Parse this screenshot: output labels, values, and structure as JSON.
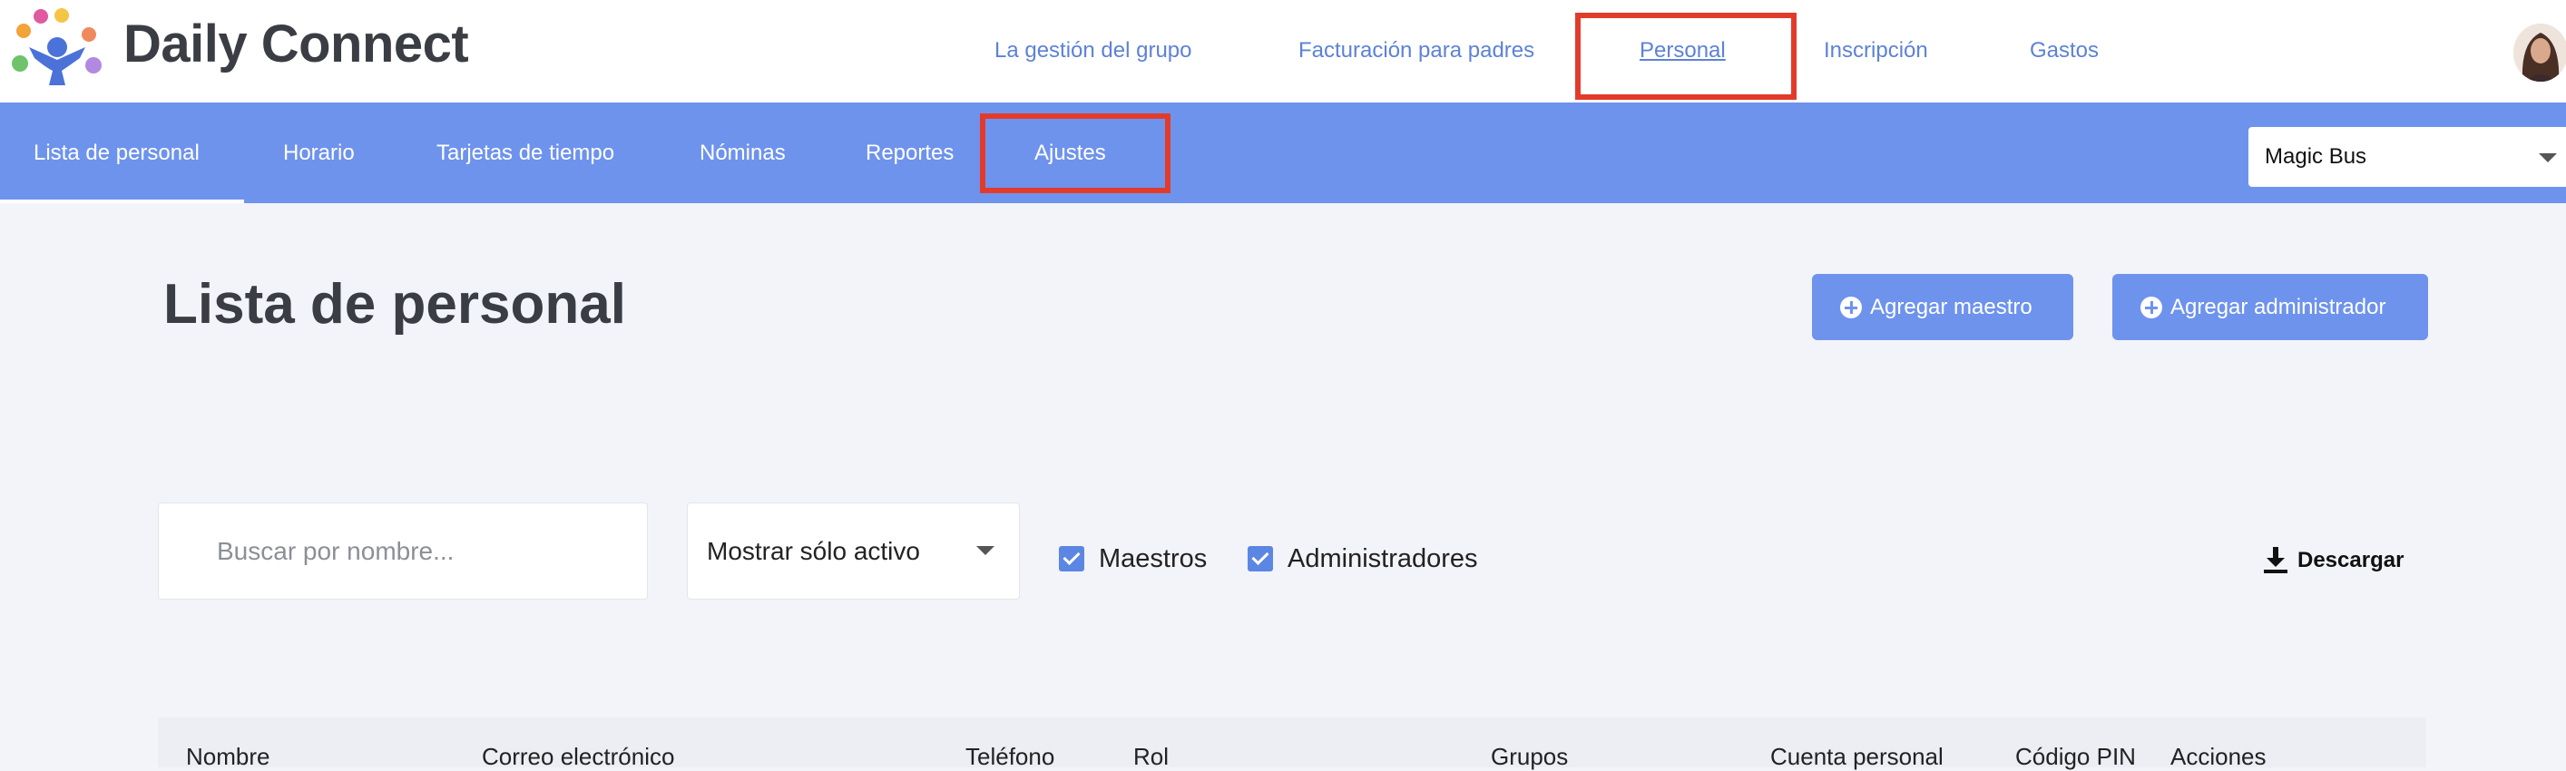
{
  "app": {
    "brand": "Daily Connect",
    "colors": {
      "accent": "#6e93ed",
      "highlight": "#e33b2b",
      "link": "#5d82d6"
    }
  },
  "top_nav": {
    "items": [
      {
        "label": "La gestión del grupo"
      },
      {
        "label": "Facturación para padres"
      },
      {
        "label": "Personal",
        "active": true
      },
      {
        "label": "Inscripción"
      },
      {
        "label": "Gastos"
      }
    ]
  },
  "sub_nav": {
    "items": [
      {
        "label": "Lista de personal",
        "active": true
      },
      {
        "label": "Horario"
      },
      {
        "label": "Tarjetas de tiempo"
      },
      {
        "label": "Nóminas"
      },
      {
        "label": "Reportes"
      },
      {
        "label": "Ajustes"
      }
    ],
    "school_select": {
      "value": "Magic Bus"
    }
  },
  "main": {
    "title": "Lista de personal",
    "add_teacher_label": "Agregar maestro",
    "add_admin_label": "Agregar administrador",
    "search_placeholder": "Buscar por nombre...",
    "status_filter": "Mostrar sólo activo",
    "filters": {
      "teachers": {
        "label": "Maestros",
        "checked": true
      },
      "admins": {
        "label": "Administradores",
        "checked": true
      }
    },
    "download_label": "Descargar"
  },
  "table": {
    "columns": [
      "Nombre",
      "Correo electrónico",
      "Teléfono",
      "Rol",
      "Grupos",
      "Cuenta personal",
      "Código PIN",
      "Acciones"
    ]
  }
}
